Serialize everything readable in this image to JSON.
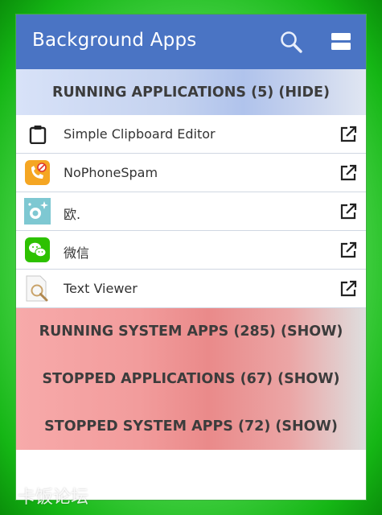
{
  "app": {
    "title": "Background Apps",
    "accent_color": "#4a74c4",
    "search_icon": "search-icon",
    "menu_icon": "menu-icon"
  },
  "sections": {
    "running": "RUNNING APPLICATIONS (5) (HIDE)",
    "running_system": "RUNNING SYSTEM APPS (285) (SHOW)",
    "stopped": "STOPPED APPLICATIONS (67) (SHOW)",
    "stopped_system": "STOPPED SYSTEM APPS (72) (SHOW)"
  },
  "running_apps": [
    {
      "label": "Simple Clipboard Editor",
      "icon": "clipboard-icon"
    },
    {
      "label": "NoPhoneSpam",
      "icon": "no-phone-spam-icon"
    },
    {
      "label": "欧.",
      "icon": "camera-sparkle-icon"
    },
    {
      "label": "微信",
      "icon": "wechat-icon"
    },
    {
      "label": "Text Viewer",
      "icon": "text-viewer-icon"
    }
  ],
  "watermark": "卡饭论坛"
}
